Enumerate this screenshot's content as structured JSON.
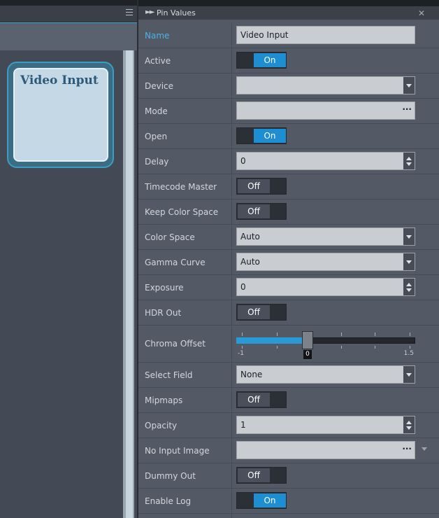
{
  "node": {
    "title": "Video Input"
  },
  "panel": {
    "title": "Pin Values"
  },
  "rows": {
    "name": {
      "label": "Name",
      "value": "Video Input"
    },
    "active": {
      "label": "Active",
      "value": "On"
    },
    "device": {
      "label": "Device",
      "value": ""
    },
    "mode": {
      "label": "Mode",
      "value": ""
    },
    "open": {
      "label": "Open",
      "value": "On"
    },
    "delay": {
      "label": "Delay",
      "value": "0"
    },
    "timecode_master": {
      "label": "Timecode Master",
      "value": "Off"
    },
    "keep_color_space": {
      "label": "Keep Color Space",
      "value": "Off"
    },
    "color_space": {
      "label": "Color Space",
      "value": "Auto"
    },
    "gamma_curve": {
      "label": "Gamma Curve",
      "value": "Auto"
    },
    "exposure": {
      "label": "Exposure",
      "value": "0"
    },
    "hdr_out": {
      "label": "HDR Out",
      "value": "Off"
    },
    "chroma_offset": {
      "label": "Chroma Offset",
      "min_label": "-1",
      "max_label": "1.5",
      "value_label": "0",
      "min": -1,
      "max": 1.5,
      "value": 0
    },
    "select_field": {
      "label": "Select Field",
      "value": "None"
    },
    "mipmaps": {
      "label": "Mipmaps",
      "value": "Off"
    },
    "opacity": {
      "label": "Opacity",
      "value": "1"
    },
    "no_input_image": {
      "label": "No Input Image",
      "value": ""
    },
    "dummy_out": {
      "label": "Dummy Out",
      "value": "Off"
    },
    "enable_log": {
      "label": "Enable Log",
      "value": "On"
    }
  },
  "glyphs": {
    "ellipsis": "···",
    "fast_forward": "►►",
    "close": "✕"
  },
  "colors": {
    "accent": "#1e8ed3",
    "label_accent": "#4ab4e8",
    "panel_bg": "#535a66",
    "node_bg": "#c4d8e6"
  }
}
